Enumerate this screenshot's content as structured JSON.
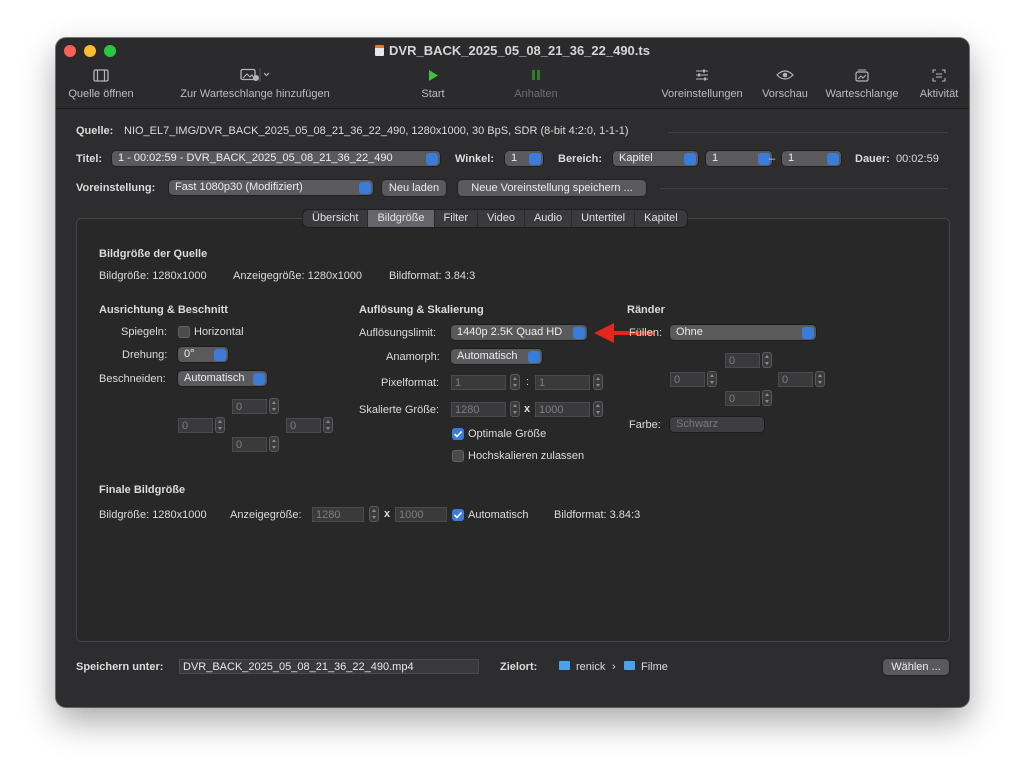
{
  "window": {
    "title": "DVR_BACK_2025_05_08_21_36_22_490.ts"
  },
  "toolbar": {
    "open_source": "Quelle öffnen",
    "add_queue": "Zur Warteschlange hinzufügen",
    "start": "Start",
    "pause": "Anhalten",
    "presets": "Voreinstellungen",
    "preview": "Vorschau",
    "queue": "Warteschlange",
    "activity": "Aktivität"
  },
  "source": {
    "label": "Quelle:",
    "value": "NIO_EL7_IMG/DVR_BACK_2025_05_08_21_36_22_490, 1280x1000, 30 BpS, SDR (8-bit 4:2:0, 1-1-1)"
  },
  "title_row": {
    "title_label": "Titel:",
    "title_value": "1 - 00:02:59 - DVR_BACK_2025_05_08_21_36_22_490",
    "angle_label": "Winkel:",
    "angle_value": "1",
    "range_label": "Bereich:",
    "range_type": "Kapitel",
    "range_from": "1",
    "range_dash": "–",
    "range_to": "1",
    "duration_label": "Dauer:",
    "duration_value": "00:02:59"
  },
  "preset_row": {
    "label": "Voreinstellung:",
    "value": "Fast 1080p30 (Modifiziert)",
    "reload": "Neu laden",
    "save_new": "Neue Voreinstellung speichern ..."
  },
  "tabs": [
    "Übersicht",
    "Bildgröße",
    "Filter",
    "Video",
    "Audio",
    "Untertitel",
    "Kapitel"
  ],
  "selected_tab": "Bildgröße",
  "source_size": {
    "heading": "Bildgröße der Quelle",
    "size": "Bildgröße: 1280x1000",
    "display": "Anzeigegröße: 1280x1000",
    "aspect": "Bildformat:  3.84:3"
  },
  "orientation": {
    "heading": "Ausrichtung & Beschnitt",
    "mirror_label": "Spiegeln:",
    "mirror_option": "Horizontal",
    "rotation_label": "Drehung:",
    "rotation_value": "0°",
    "crop_label": "Beschneiden:",
    "crop_value": "Automatisch",
    "crop_top": "0",
    "crop_left": "0",
    "crop_right": "0",
    "crop_bottom": "0"
  },
  "resolution": {
    "heading": "Auflösung & Skalierung",
    "limit_label": "Auflösungslimit:",
    "limit_value": "1440p 2.5K Quad HD",
    "anamorphic_label": "Anamorph:",
    "anamorphic_value": "Automatisch",
    "pixel_label": "Pixelformat:",
    "pixel_w": "1",
    "pixel_colon": ":",
    "pixel_h": "1",
    "scaled_label": "Skalierte Größe:",
    "scaled_w": "1280",
    "scaled_x": "x",
    "scaled_h": "1000",
    "optimal": "Optimale Größe",
    "upscale": "Hochskalieren zulassen"
  },
  "borders": {
    "heading": "Ränder",
    "fill_label": "Füllen:",
    "fill_value": "Ohne",
    "top": "0",
    "left": "0",
    "right": "0",
    "bottom": "0",
    "color_label": "Farbe:",
    "color_value": "Schwarz"
  },
  "final_size": {
    "heading": "Finale Bildgröße",
    "size": "Bildgröße: 1280x1000",
    "display_label": "Anzeigegröße:",
    "display_w": "1280",
    "display_x": "x",
    "display_h": "1000",
    "automatic": "Automatisch",
    "aspect": "Bildformat:  3.84:3"
  },
  "save": {
    "label": "Speichern unter:",
    "filename": "DVR_BACK_2025_05_08_21_36_22_490.mp4",
    "dest_label": "Zielort:",
    "dest_user": "renick",
    "dest_sep": "›",
    "dest_folder": "Filme",
    "choose": "Wählen ..."
  },
  "colors": {
    "accent": "#3b7cd9",
    "arrow": "#e5261d",
    "play": "#3fbf3f"
  }
}
